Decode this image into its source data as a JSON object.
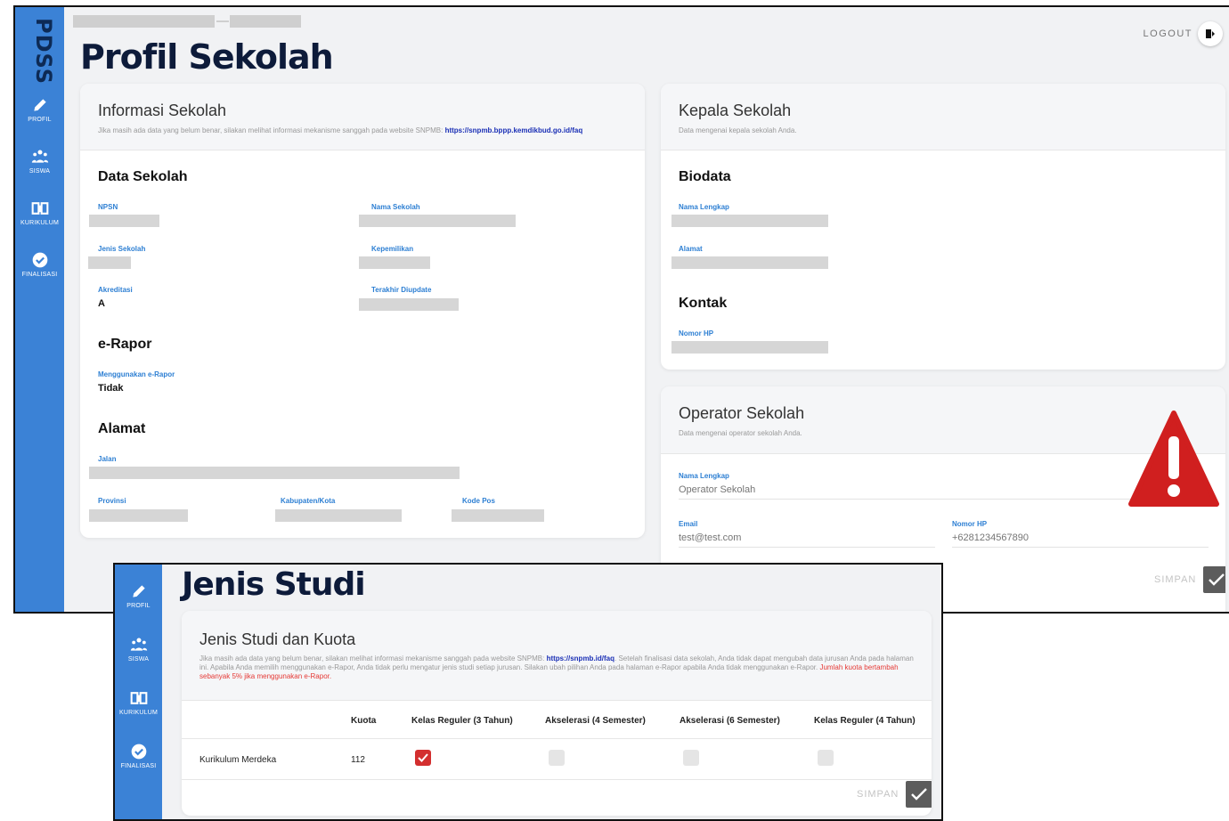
{
  "app": {
    "brand": "PDSS"
  },
  "nav": [
    {
      "label": "PROFIL",
      "icon": "pencil-icon"
    },
    {
      "label": "SISWA",
      "icon": "users-icon"
    },
    {
      "label": "KURIKULUM",
      "icon": "book-icon"
    },
    {
      "label": "FINALISASI",
      "icon": "check-circle-icon"
    }
  ],
  "header": {
    "title": "Profil Sekolah",
    "logout_label": "LOGOUT"
  },
  "info_sekolah": {
    "title": "Informasi Sekolah",
    "subtitle": "Jika masih ada data yang belum benar, silakan melihat informasi mekanisme sanggah pada website SNPMB:",
    "link": "https://snpmb.bppp.kemdikbud.go.id/faq",
    "data_sekolah": {
      "heading": "Data Sekolah",
      "npsn_label": "NPSN",
      "nama_label": "Nama Sekolah",
      "jenis_label": "Jenis Sekolah",
      "kepemilikan_label": "Kepemilikan",
      "akreditasi_label": "Akreditasi",
      "akreditasi_value": "A",
      "update_label": "Terakhir Diupdate"
    },
    "erapor": {
      "heading": "e-Rapor",
      "label": "Menggunakan e-Rapor",
      "value": "Tidak"
    },
    "alamat": {
      "heading": "Alamat",
      "jalan_label": "Jalan",
      "provinsi_label": "Provinsi",
      "kabupaten_label": "Kabupaten/Kota",
      "kodepos_label": "Kode Pos"
    }
  },
  "kepala_sekolah": {
    "title": "Kepala Sekolah",
    "subtitle": "Data mengenai kepala sekolah Anda.",
    "biodata_heading": "Biodata",
    "nama_label": "Nama Lengkap",
    "alamat_label": "Alamat",
    "kontak_heading": "Kontak",
    "hp_label": "Nomor HP"
  },
  "operator_sekolah": {
    "title": "Operator Sekolah",
    "subtitle": "Data mengenai operator sekolah Anda.",
    "nama_label": "Nama Lengkap",
    "nama_placeholder": "Operator Sekolah",
    "email_label": "Email",
    "email_placeholder": "test@test.com",
    "hp_label": "Nomor HP",
    "hp_placeholder": "+6281234567890",
    "save_label": "SIMPAN"
  },
  "jenis_studi": {
    "page_title": "Jenis Studi",
    "card_title": "Jenis Studi dan Kuota",
    "desc_before_link": "Jika masih ada data yang belum benar, silakan melihat informasi mekanisme sanggah pada website SNPMB:",
    "link": "https://snpmb.id/faq",
    "desc_after_link": ". Setelah finalisasi data sekolah, Anda tidak dapat mengubah data jurusan Anda pada halaman ini. Apabila Anda memilih menggunakan e-Rapor, Anda tidak perlu mengatur jenis studi setiap jurusan. Silakan ubah pilihan Anda pada halaman e-Rapor apabila Anda tidak menggunakan e-Rapor.",
    "desc_red": "Jumlah kuota bertambah sebanyak 5% jika menggunakan e-Rapor.",
    "columns": [
      "Kuota",
      "Kelas Reguler (3 Tahun)",
      "Akselerasi (4 Semester)",
      "Akselerasi (6 Semester)",
      "Kelas Reguler (4 Tahun)"
    ],
    "rows": [
      {
        "name": "Kurikulum Merdeka",
        "kuota": "112",
        "checks": [
          true,
          false,
          false,
          false
        ]
      }
    ],
    "save_label": "SIMPAN"
  },
  "colors": {
    "sidebar": "#3b82d6",
    "accent_label": "#2d7fd3",
    "warning": "#d01f1f",
    "checked": "#d32f2f"
  }
}
